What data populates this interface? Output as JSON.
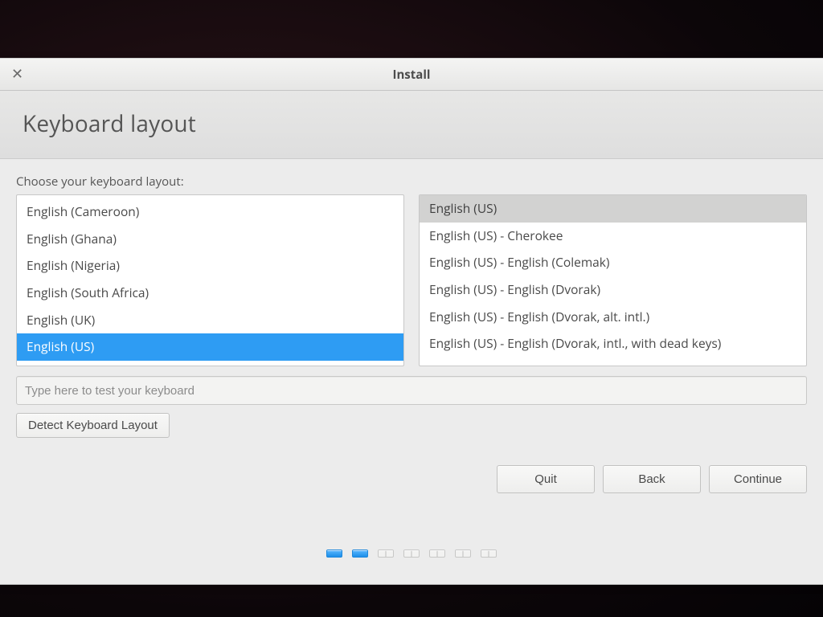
{
  "window": {
    "title": "Install"
  },
  "header": {
    "title": "Keyboard layout"
  },
  "prompt": "Choose your keyboard layout:",
  "layouts_left": [
    {
      "label": "English (Cameroon)",
      "selected": false
    },
    {
      "label": "English (Ghana)",
      "selected": false
    },
    {
      "label": "English (Nigeria)",
      "selected": false
    },
    {
      "label": "English (South Africa)",
      "selected": false
    },
    {
      "label": "English (UK)",
      "selected": false
    },
    {
      "label": "English (US)",
      "selected": true
    }
  ],
  "layouts_right": [
    {
      "label": "English (US)",
      "selected": true
    },
    {
      "label": "English (US) - Cherokee",
      "selected": false
    },
    {
      "label": "English (US) - English (Colemak)",
      "selected": false
    },
    {
      "label": "English (US) - English (Dvorak)",
      "selected": false
    },
    {
      "label": "English (US) - English (Dvorak, alt. intl.)",
      "selected": false
    },
    {
      "label": "English (US) - English (Dvorak, intl., with dead keys)",
      "selected": false
    }
  ],
  "test_input": {
    "placeholder": "Type here to test your keyboard",
    "value": ""
  },
  "buttons": {
    "detect": "Detect Keyboard Layout",
    "quit": "Quit",
    "back": "Back",
    "continue": "Continue"
  },
  "progress": {
    "total": 7,
    "done": 2
  }
}
